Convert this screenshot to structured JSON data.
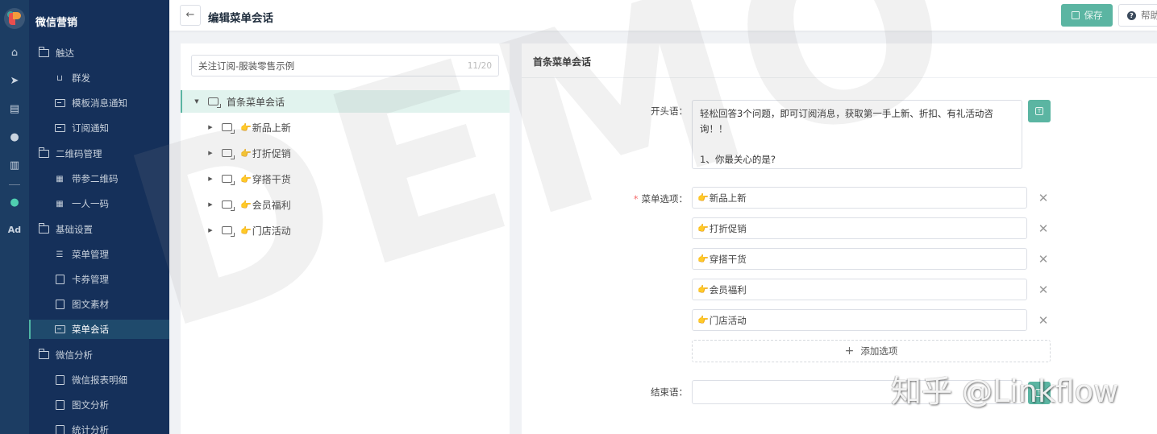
{
  "app": {
    "title": "微信营销"
  },
  "rail": {
    "icons": [
      "home-icon",
      "send-icon",
      "layout-icon",
      "user-icon",
      "bar-chart-icon",
      "wechat-icon",
      "ad-icon"
    ],
    "ad_label": "Ad"
  },
  "nav": {
    "groups": [
      {
        "label": "触达",
        "items": [
          "群发",
          "模板消息通知",
          "订阅通知"
        ]
      },
      {
        "label": "二维码管理",
        "items": [
          "带参二维码",
          "一人一码"
        ]
      },
      {
        "label": "基础设置",
        "items": [
          "菜单管理",
          "卡券管理",
          "图文素材",
          "菜单会话"
        ]
      },
      {
        "label": "微信分析",
        "items": [
          "微信报表明细",
          "图文分析",
          "统计分析"
        ]
      }
    ],
    "active_item": "菜单会话"
  },
  "header": {
    "back_label": "←",
    "title": "编辑菜单会话",
    "save_label": "保存",
    "help_label": "帮助",
    "accent_color": "#5bb5a2"
  },
  "tree": {
    "name_value": "关注订阅-服装零售示例",
    "name_count": "11/20",
    "root": {
      "label": "首条菜单会话",
      "expanded": true
    },
    "children": [
      {
        "emoji": "👉",
        "label": "新品上新"
      },
      {
        "emoji": "👉",
        "label": "打折促销"
      },
      {
        "emoji": "👉",
        "label": "穿搭干货"
      },
      {
        "emoji": "👉",
        "label": "会员福利"
      },
      {
        "emoji": "👉",
        "label": "门店活动"
      }
    ]
  },
  "form": {
    "card_title": "首条菜单会话",
    "opening_label": "开头语：",
    "opening_text": "轻松回答3个问题，即可订阅消息，获取第一手上新、折扣、有礼活动咨询！！\n\n1、你最关心的是?",
    "options_label": "菜单选项：",
    "options_required": "*",
    "options": [
      {
        "emoji": "👉",
        "label": "新品上新"
      },
      {
        "emoji": "👉",
        "label": "打折促销"
      },
      {
        "emoji": "👉",
        "label": "穿搭干货"
      },
      {
        "emoji": "👉",
        "label": "会员福利"
      },
      {
        "emoji": "👉",
        "label": "门店活动"
      }
    ],
    "remove_label": "✕",
    "add_option_label": "添加选项",
    "closing_label": "结束语：",
    "closing_text": ""
  },
  "watermarks": {
    "demo": "DEMO",
    "zhihu": "知乎 @Linkflow"
  }
}
